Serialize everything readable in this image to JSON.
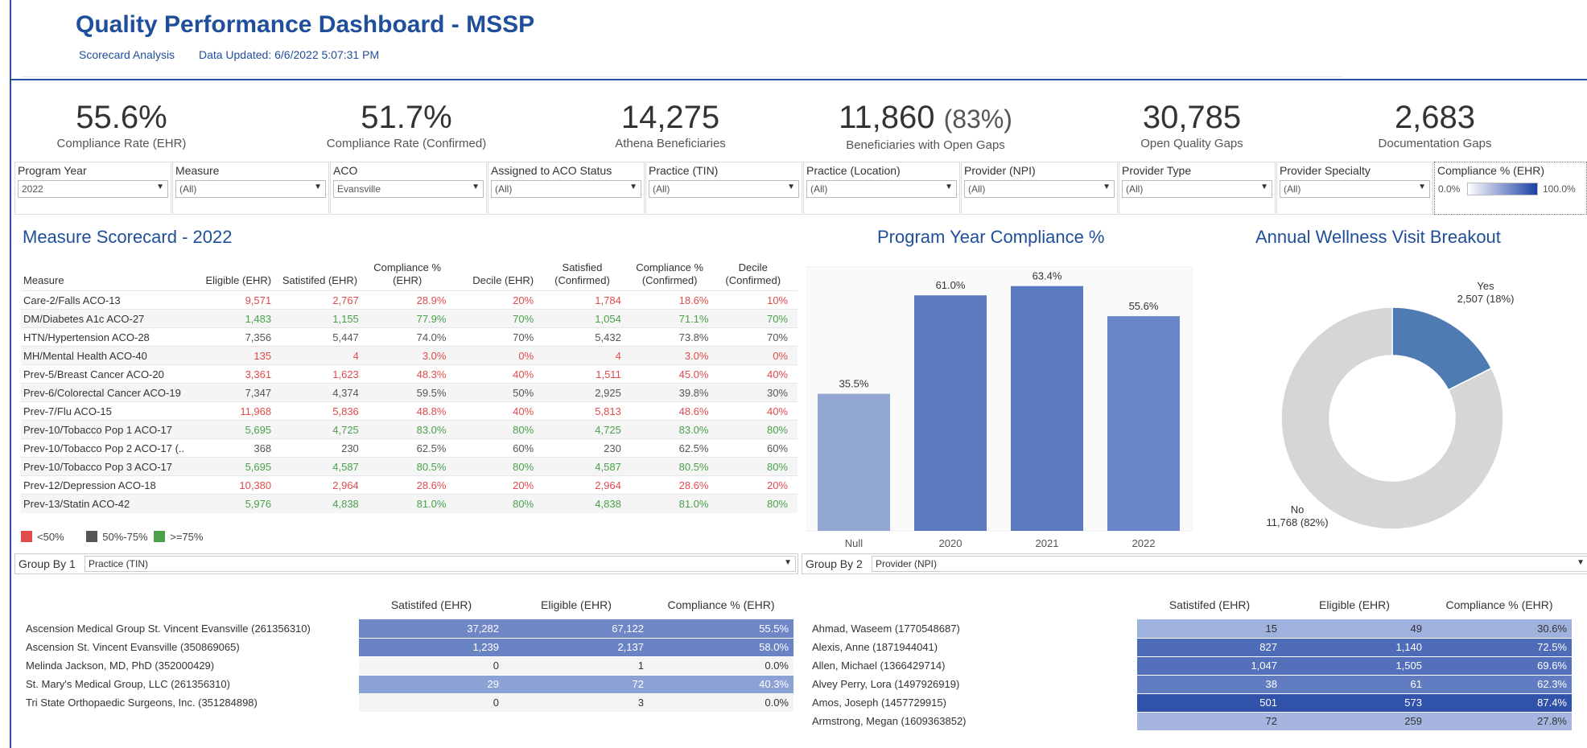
{
  "header": {
    "title": "Quality Performance Dashboard - MSSP",
    "subtitle_link": "Scorecard Analysis",
    "updated": "Data Updated: 6/6/2022 5:07:31 PM"
  },
  "kpis": [
    {
      "value": "55.6%",
      "label": "Compliance Rate (EHR)"
    },
    {
      "value": "51.7%",
      "label": "Compliance Rate (Confirmed)"
    },
    {
      "value": "14,275",
      "label": "Athena Beneficiaries"
    },
    {
      "value": "11,860",
      "extra": "(83%)",
      "label": "Beneficiaries with Open Gaps"
    },
    {
      "value": "30,785",
      "label": "Open Quality Gaps"
    },
    {
      "value": "2,683",
      "label": "Documentation Gaps"
    }
  ],
  "filters": [
    {
      "label": "Program Year",
      "value": "2022"
    },
    {
      "label": "Measure",
      "value": "(All)"
    },
    {
      "label": "ACO",
      "value": "Evansville"
    },
    {
      "label": "Assigned to ACO Status",
      "value": "(All)"
    },
    {
      "label": "Practice (TIN)",
      "value": "(All)"
    },
    {
      "label": "Practice (Location)",
      "value": "(All)"
    },
    {
      "label": "Provider (NPI)",
      "value": "(All)"
    },
    {
      "label": "Provider Type",
      "value": "(All)"
    },
    {
      "label": "Provider Specialty",
      "value": "(All)"
    },
    {
      "label": "Compliance % (EHR)",
      "min": "0.0%",
      "max": "100.0%"
    }
  ],
  "scorecard": {
    "title": "Measure Scorecard - 2022",
    "headers": [
      "Measure",
      "Eligible (EHR)",
      "Satistifed (EHR)",
      "Compliance % (EHR)",
      "Decile (EHR)",
      "Satisfied (Confirmed)",
      "Compliance % (Confirmed)",
      "Decile (Confirmed)"
    ],
    "rows": [
      {
        "measure": "Care-2/Falls ACO-13",
        "cells": [
          "9,571",
          "2,767",
          "28.9%",
          "20%",
          "1,784",
          "18.6%",
          "10%"
        ],
        "cls": [
          "r",
          "r",
          "r",
          "r",
          "r",
          "r",
          "r"
        ]
      },
      {
        "measure": "DM/Diabetes A1c ACO-27",
        "cells": [
          "1,483",
          "1,155",
          "77.9%",
          "70%",
          "1,054",
          "71.1%",
          "70%"
        ],
        "cls": [
          "g",
          "g",
          "g",
          "g",
          "g",
          "g",
          "g"
        ]
      },
      {
        "measure": "HTN/Hypertension ACO-28",
        "cells": [
          "7,356",
          "5,447",
          "74.0%",
          "70%",
          "5,432",
          "73.8%",
          "70%"
        ],
        "cls": [
          "k",
          "k",
          "k",
          "k",
          "k",
          "k",
          "k"
        ]
      },
      {
        "measure": "MH/Mental Health ACO-40",
        "cells": [
          "135",
          "4",
          "3.0%",
          "0%",
          "4",
          "3.0%",
          "0%"
        ],
        "cls": [
          "r",
          "r",
          "r",
          "r",
          "r",
          "r",
          "r"
        ]
      },
      {
        "measure": "Prev-5/Breast Cancer ACO-20",
        "cells": [
          "3,361",
          "1,623",
          "48.3%",
          "40%",
          "1,511",
          "45.0%",
          "40%"
        ],
        "cls": [
          "r",
          "r",
          "r",
          "r",
          "r",
          "r",
          "r"
        ]
      },
      {
        "measure": "Prev-6/Colorectal Cancer ACO-19",
        "cells": [
          "7,347",
          "4,374",
          "59.5%",
          "50%",
          "2,925",
          "39.8%",
          "30%"
        ],
        "cls": [
          "k",
          "k",
          "k",
          "k",
          "k",
          "k",
          "k"
        ]
      },
      {
        "measure": "Prev-7/Flu ACO-15",
        "cells": [
          "11,968",
          "5,836",
          "48.8%",
          "40%",
          "5,813",
          "48.6%",
          "40%"
        ],
        "cls": [
          "r",
          "r",
          "r",
          "r",
          "r",
          "r",
          "r"
        ]
      },
      {
        "measure": "Prev-10/Tobacco Pop 1 ACO-17",
        "cells": [
          "5,695",
          "4,725",
          "83.0%",
          "80%",
          "4,725",
          "83.0%",
          "80%"
        ],
        "cls": [
          "g",
          "g",
          "g",
          "g",
          "g",
          "g",
          "g"
        ]
      },
      {
        "measure": "Prev-10/Tobacco Pop 2 ACO-17 (..",
        "cells": [
          "368",
          "230",
          "62.5%",
          "60%",
          "230",
          "62.5%",
          "60%"
        ],
        "cls": [
          "k",
          "k",
          "k",
          "k",
          "k",
          "k",
          "k"
        ]
      },
      {
        "measure": "Prev-10/Tobacco Pop 3 ACO-17",
        "cells": [
          "5,695",
          "4,587",
          "80.5%",
          "80%",
          "4,587",
          "80.5%",
          "80%"
        ],
        "cls": [
          "g",
          "g",
          "g",
          "g",
          "g",
          "g",
          "g"
        ]
      },
      {
        "measure": "Prev-12/Depression ACO-18",
        "cells": [
          "10,380",
          "2,964",
          "28.6%",
          "20%",
          "2,964",
          "28.6%",
          "20%"
        ],
        "cls": [
          "r",
          "r",
          "r",
          "r",
          "r",
          "r",
          "r"
        ]
      },
      {
        "measure": "Prev-13/Statin ACO-42",
        "cells": [
          "5,976",
          "4,838",
          "81.0%",
          "80%",
          "4,838",
          "81.0%",
          "80%"
        ],
        "cls": [
          "g",
          "g",
          "g",
          "g",
          "g",
          "g",
          "g"
        ]
      }
    ]
  },
  "legend": [
    {
      "label": "<50%",
      "color": "#e14b4b"
    },
    {
      "label": "50%-75%",
      "color": "#555555"
    },
    {
      "label": ">=75%",
      "color": "#4aa14a"
    }
  ],
  "groupby1": {
    "label": "Group By 1",
    "value": "Practice (TIN)"
  },
  "groupby2": {
    "label": "Group By 2",
    "value": "Provider (NPI)"
  },
  "chart_data": [
    {
      "type": "bar",
      "title": "Program Year Compliance %",
      "categories": [
        "Null",
        "2020",
        "2021",
        "2022"
      ],
      "values": [
        35.5,
        61.0,
        63.4,
        55.6
      ],
      "labels": [
        "35.5%",
        "61.0%",
        "63.4%",
        "55.6%"
      ],
      "colors": [
        "#93a7d4",
        "#5b7ac0",
        "#5b7ac0",
        "#6a86c8"
      ],
      "ylim": [
        0,
        65
      ]
    },
    {
      "type": "pie",
      "title": "Annual Wellness Visit Breakout",
      "slices": [
        {
          "name": "Yes",
          "label": "2,507 (18%)",
          "value": 2507,
          "color": "#4e7bb2"
        },
        {
          "name": "No",
          "label": "11,768 (82%)",
          "value": 11768,
          "color": "#d6d6d6"
        }
      ]
    }
  ],
  "practice_table": {
    "headers": [
      "Satistifed (EHR)",
      "Eligible (EHR)",
      "Compliance % (EHR)"
    ],
    "rows": [
      {
        "name": "Ascension Medical Group St. Vincent Evansville (261356310)",
        "cells": [
          "37,282",
          "67,122",
          "55.5%"
        ],
        "level": 0.555
      },
      {
        "name": "Ascension St. Vincent Evansville (350869065)",
        "cells": [
          "1,239",
          "2,137",
          "58.0%"
        ],
        "level": 0.58
      },
      {
        "name": "Melinda Jackson, MD, PhD (352000429)",
        "cells": [
          "0",
          "1",
          "0.0%"
        ],
        "level": 0.0
      },
      {
        "name": "St. Mary's Medical Group, LLC (261356310)",
        "cells": [
          "29",
          "72",
          "40.3%"
        ],
        "level": 0.403
      },
      {
        "name": "Tri State Orthopaedic Surgeons, Inc. (351284898)",
        "cells": [
          "0",
          "3",
          "0.0%"
        ],
        "level": 0.0
      }
    ]
  },
  "provider_table": {
    "headers": [
      "Satistifed (EHR)",
      "Eligible (EHR)",
      "Compliance % (EHR)"
    ],
    "rows": [
      {
        "name": "Ahmad, Waseem (1770548687)",
        "cells": [
          "15",
          "49",
          "30.6%"
        ],
        "level": 0.306
      },
      {
        "name": "Alexis, Anne (1871944041)",
        "cells": [
          "827",
          "1,140",
          "72.5%"
        ],
        "level": 0.725
      },
      {
        "name": "Allen, Michael (1366429714)",
        "cells": [
          "1,047",
          "1,505",
          "69.6%"
        ],
        "level": 0.696
      },
      {
        "name": "Alvey Perry, Lora (1497926919)",
        "cells": [
          "38",
          "61",
          "62.3%"
        ],
        "level": 0.623
      },
      {
        "name": "Amos, Joseph (1457729915)",
        "cells": [
          "501",
          "573",
          "87.4%"
        ],
        "level": 0.874
      },
      {
        "name": "Armstrong, Megan (1609363852)",
        "cells": [
          "72",
          "259",
          "27.8%"
        ],
        "level": 0.278
      }
    ]
  }
}
